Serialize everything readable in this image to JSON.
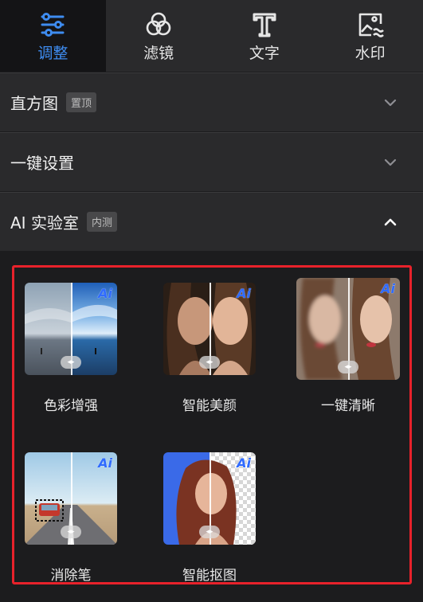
{
  "tabs": [
    {
      "label": "调整",
      "icon": "sliders-icon",
      "active": true
    },
    {
      "label": "滤镜",
      "icon": "filter-circles-icon",
      "active": false
    },
    {
      "label": "文字",
      "icon": "text-t-icon",
      "active": false
    },
    {
      "label": "水印",
      "icon": "watermark-image-icon",
      "active": false
    }
  ],
  "sections": [
    {
      "title": "直方图",
      "badge": "置顶",
      "expanded": false
    },
    {
      "title": "一键设置",
      "badge": "",
      "expanded": false
    },
    {
      "title": "AI 实验室",
      "badge": "内测",
      "expanded": true
    }
  ],
  "ai_lab": {
    "tools": [
      {
        "label": "色彩增强",
        "badge": "Ai"
      },
      {
        "label": "智能美颜",
        "badge": "Ai"
      },
      {
        "label": "一键清晰",
        "badge": "Ai"
      },
      {
        "label": "消除笔",
        "badge": "Ai"
      },
      {
        "label": "智能抠图",
        "badge": "Ai"
      }
    ]
  },
  "colors": {
    "accent": "#3e8cf0",
    "highlight_box": "#e8222b",
    "ai_badge": "#2f6bff"
  }
}
